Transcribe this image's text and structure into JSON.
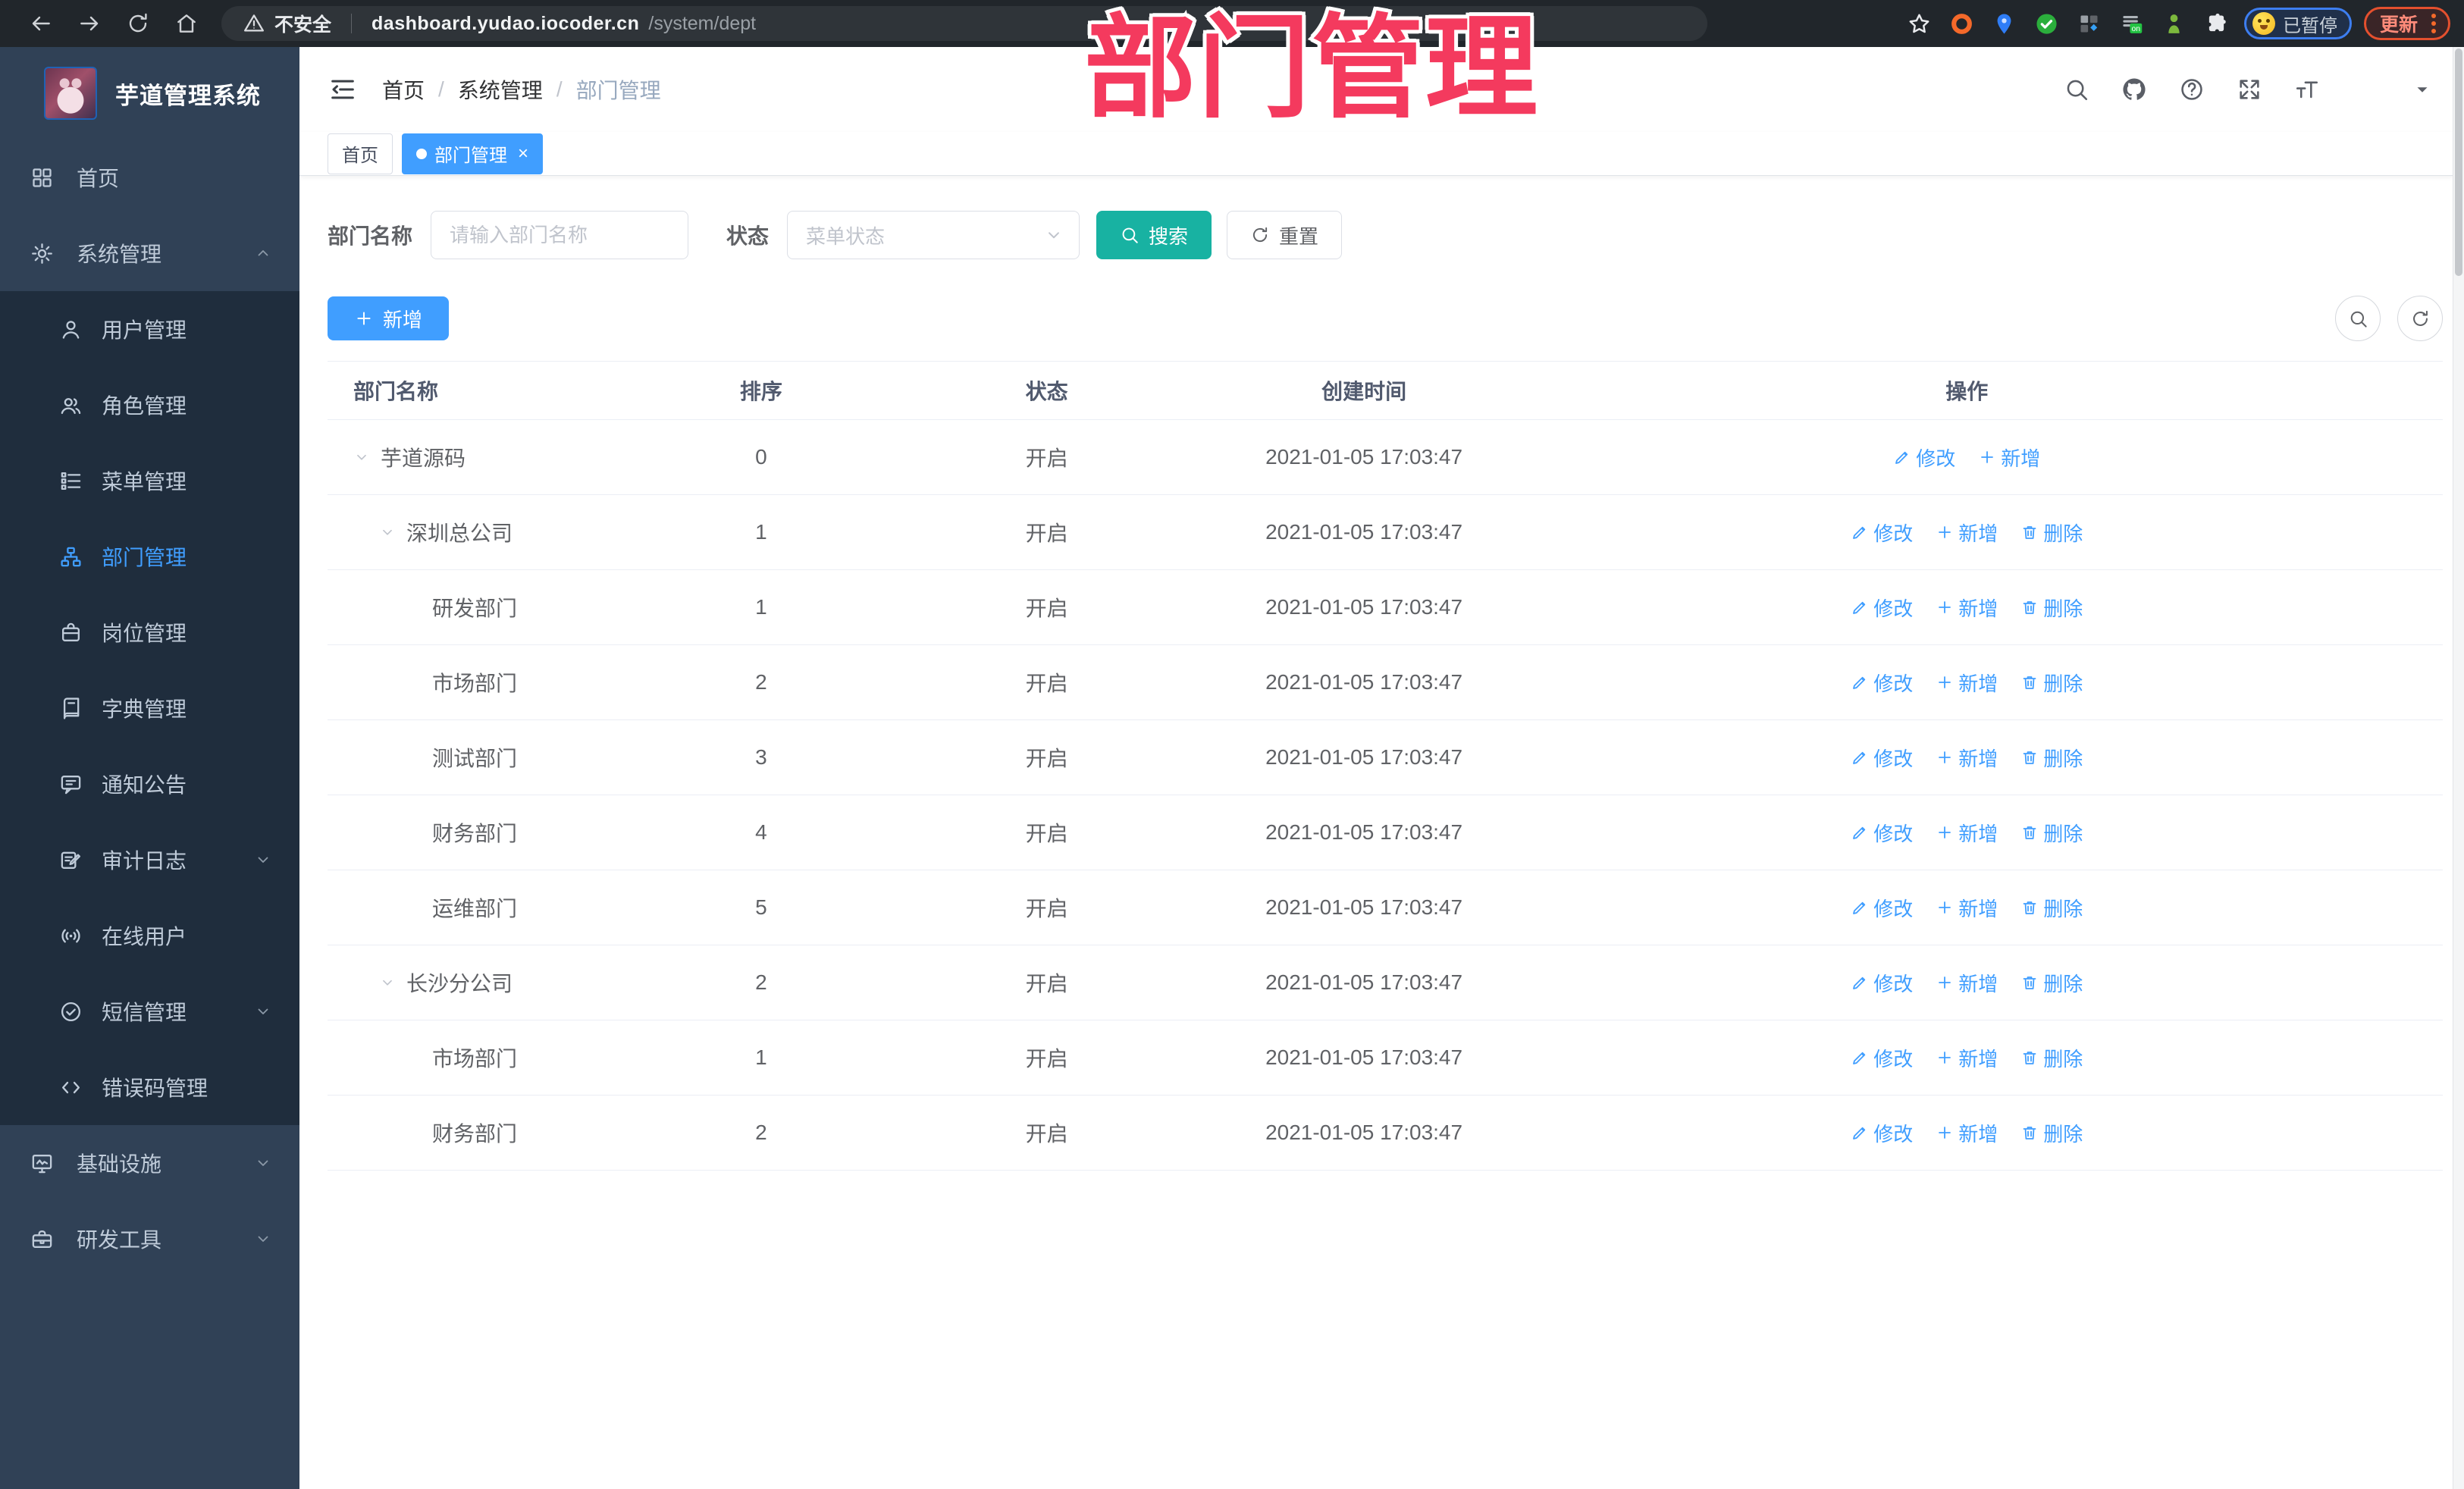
{
  "colors": {
    "accent_blue": "#409EFF",
    "search_teal": "#18B2A2",
    "sidebar_bg": "#304156",
    "sidebar_submenu_bg": "#1F2D3D",
    "annotation_pink": "#F43A5E",
    "paused_ring_blue": "#3D7EF0",
    "update_ring_red": "#E4502E"
  },
  "browser": {
    "security_label": "不安全",
    "url_host": "dashboard.yudao.iocoder.cn",
    "url_path": "/system/dept",
    "paused_label": "已暂停",
    "update_label": "更新",
    "on_badge": "on",
    "nav_icons": [
      "back-icon",
      "forward-icon",
      "reload-icon",
      "home-nav-icon"
    ],
    "extension_icons": [
      "ext-orange-ring-icon",
      "ext-location-pin-icon",
      "ext-green-check-icon",
      "ext-grid-icon",
      "ext-on-badge-icon",
      "ext-green-figure-icon",
      "ext-puzzle-icon"
    ]
  },
  "annotation": {
    "text": "部门管理"
  },
  "sidebar": {
    "title": "芋道管理系统",
    "items": [
      {
        "label": "首页",
        "icon": "dashboard-icon",
        "level": "top"
      },
      {
        "label": "系统管理",
        "icon": "gear-icon",
        "level": "top",
        "chevron": "up"
      },
      {
        "label": "用户管理",
        "icon": "user-icon",
        "level": "sub"
      },
      {
        "label": "角色管理",
        "icon": "users-icon",
        "level": "sub"
      },
      {
        "label": "菜单管理",
        "icon": "menu-list-icon",
        "level": "sub"
      },
      {
        "label": "部门管理",
        "icon": "org-chart-icon",
        "level": "sub",
        "active": true
      },
      {
        "label": "岗位管理",
        "icon": "badge-icon",
        "level": "sub"
      },
      {
        "label": "字典管理",
        "icon": "dictionary-icon",
        "level": "sub"
      },
      {
        "label": "通知公告",
        "icon": "announcement-icon",
        "level": "sub"
      },
      {
        "label": "审计日志",
        "icon": "audit-log-icon",
        "level": "sub",
        "chevron": "down"
      },
      {
        "label": "在线用户",
        "icon": "online-users-icon",
        "level": "sub"
      },
      {
        "label": "短信管理",
        "icon": "sms-icon",
        "level": "sub",
        "chevron": "down"
      },
      {
        "label": "错误码管理",
        "icon": "error-code-icon",
        "level": "sub"
      },
      {
        "label": "基础设施",
        "icon": "infrastructure-icon",
        "level": "top",
        "chevron": "down"
      },
      {
        "label": "研发工具",
        "icon": "devtools-icon",
        "level": "top",
        "chevron": "down"
      }
    ]
  },
  "header": {
    "breadcrumb": [
      "首页",
      "系统管理",
      "部门管理"
    ],
    "action_icons": [
      "search-icon",
      "github-icon",
      "help-icon",
      "fullscreen-icon",
      "fontsize-icon"
    ]
  },
  "tabs": [
    {
      "label": "首页",
      "active": false
    },
    {
      "label": "部门管理",
      "active": true,
      "closable": true
    }
  ],
  "filters": {
    "name_label": "部门名称",
    "name_placeholder": "请输入部门名称",
    "status_label": "状态",
    "status_placeholder": "菜单状态",
    "search_label": "搜索",
    "reset_label": "重置"
  },
  "toolbar": {
    "add_label": "新增"
  },
  "table": {
    "columns": [
      "部门名称",
      "排序",
      "状态",
      "创建时间",
      "操作"
    ],
    "action_labels": {
      "edit": "修改",
      "add": "新增",
      "del": "删除"
    },
    "rows": [
      {
        "name": "芋道源码",
        "level": 0,
        "expandable": true,
        "sort": "0",
        "status": "开启",
        "created": "2021-01-05 17:03:47",
        "actions": [
          "edit",
          "add"
        ]
      },
      {
        "name": "深圳总公司",
        "level": 1,
        "expandable": true,
        "sort": "1",
        "status": "开启",
        "created": "2021-01-05 17:03:47",
        "actions": [
          "edit",
          "add",
          "del"
        ]
      },
      {
        "name": "研发部门",
        "level": 2,
        "expandable": false,
        "sort": "1",
        "status": "开启",
        "created": "2021-01-05 17:03:47",
        "actions": [
          "edit",
          "add",
          "del"
        ]
      },
      {
        "name": "市场部门",
        "level": 2,
        "expandable": false,
        "sort": "2",
        "status": "开启",
        "created": "2021-01-05 17:03:47",
        "actions": [
          "edit",
          "add",
          "del"
        ]
      },
      {
        "name": "测试部门",
        "level": 2,
        "expandable": false,
        "sort": "3",
        "status": "开启",
        "created": "2021-01-05 17:03:47",
        "actions": [
          "edit",
          "add",
          "del"
        ]
      },
      {
        "name": "财务部门",
        "level": 2,
        "expandable": false,
        "sort": "4",
        "status": "开启",
        "created": "2021-01-05 17:03:47",
        "actions": [
          "edit",
          "add",
          "del"
        ]
      },
      {
        "name": "运维部门",
        "level": 2,
        "expandable": false,
        "sort": "5",
        "status": "开启",
        "created": "2021-01-05 17:03:47",
        "actions": [
          "edit",
          "add",
          "del"
        ]
      },
      {
        "name": "长沙分公司",
        "level": 1,
        "expandable": true,
        "sort": "2",
        "status": "开启",
        "created": "2021-01-05 17:03:47",
        "actions": [
          "edit",
          "add",
          "del"
        ]
      },
      {
        "name": "市场部门",
        "level": 2,
        "expandable": false,
        "sort": "1",
        "status": "开启",
        "created": "2021-01-05 17:03:47",
        "actions": [
          "edit",
          "add",
          "del"
        ]
      },
      {
        "name": "财务部门",
        "level": 2,
        "expandable": false,
        "sort": "2",
        "status": "开启",
        "created": "2021-01-05 17:03:47",
        "actions": [
          "edit",
          "add",
          "del"
        ]
      }
    ]
  }
}
